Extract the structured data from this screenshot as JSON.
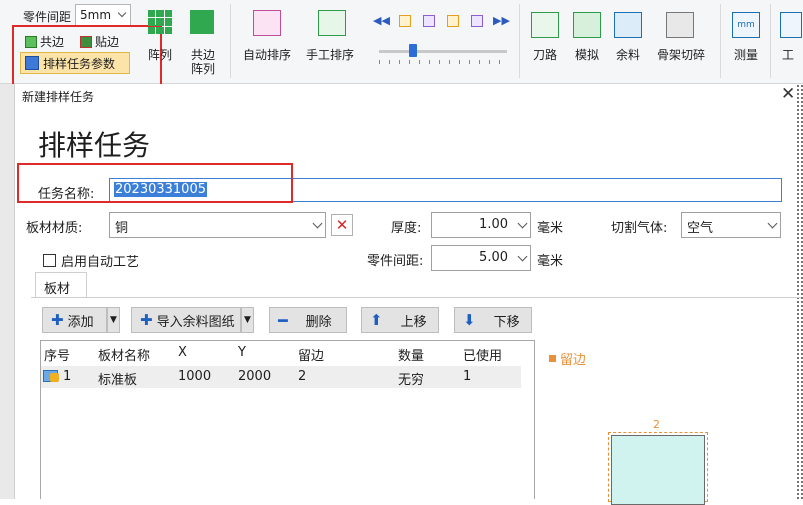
{
  "ribbon": {
    "part_spacing_label": "零件间距",
    "part_spacing_value": "5mm",
    "common_edge_label": "共边",
    "stick_edge_label": "贴边",
    "nest_params_label": "排样任务参数",
    "array_label": "阵列",
    "common_array_label_1": "共边",
    "common_array_label_2": "阵列",
    "auto_nest_label": "自动排序",
    "manual_nest_label": "手工排序",
    "knife_path_label": "刀路",
    "simulate_label": "模拟",
    "remnant_label": "余料",
    "skeleton_cut_label": "骨架切碎",
    "measure_label": "测量",
    "tool_label": "工"
  },
  "dialog": {
    "window_title": "新建排样任务",
    "heading": "排样任务",
    "task_name_label": "任务名称:",
    "task_name_value": "20230331005",
    "material_label": "板材材质:",
    "material_value": "铜",
    "thickness_label": "厚度:",
    "thickness_value": "1.00",
    "thickness_unit": "毫米",
    "gas_label": "切割气体:",
    "gas_value": "空气",
    "auto_process_label": "启用自动工艺",
    "part_gap_label": "零件间距:",
    "part_gap_value": "5.00",
    "part_gap_unit": "毫米",
    "tab_label": "板材",
    "btn_add": "添加",
    "btn_import": "导入余料图纸",
    "btn_delete": "删除",
    "btn_up": "上移",
    "btn_down": "下移",
    "table": {
      "headers": [
        "序号",
        "板材名称",
        "X",
        "Y",
        "留边",
        "数量",
        "已使用"
      ],
      "rows": [
        [
          "1",
          "标准板",
          "1000",
          "2000",
          "2",
          "无穷",
          "1"
        ]
      ]
    },
    "legend_margin": "留边",
    "preview_margin_value": "2"
  }
}
